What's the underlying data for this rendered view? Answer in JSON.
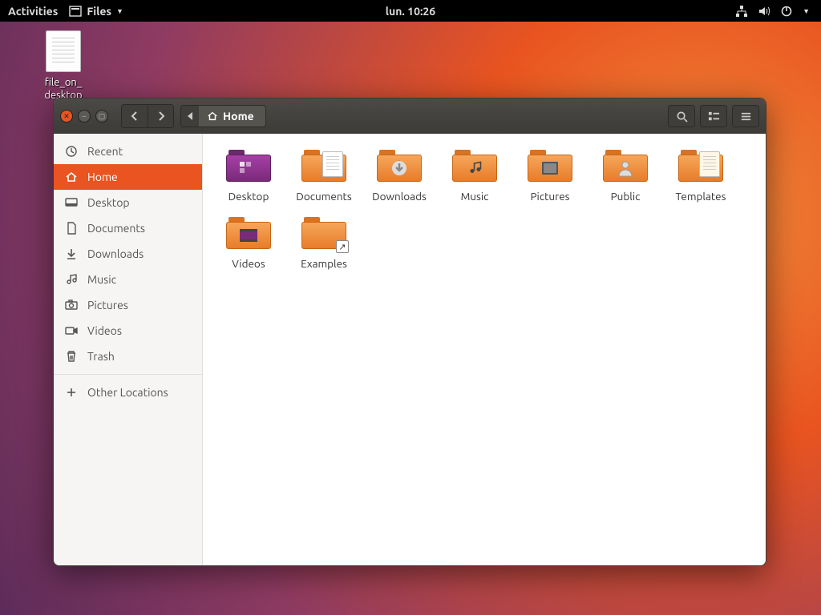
{
  "topbar": {
    "activities": "Activities",
    "app_menu": "Files",
    "clock": "lun. 10:26"
  },
  "desktop": {
    "file_line1": "file_on_",
    "file_line2": "desktop"
  },
  "window": {
    "path_segment": "Home",
    "sidebar": {
      "recent": "Recent",
      "home": "Home",
      "desktop": "Desktop",
      "documents": "Documents",
      "downloads": "Downloads",
      "music": "Music",
      "pictures": "Pictures",
      "videos": "Videos",
      "trash": "Trash",
      "other": "Other Locations"
    },
    "items": {
      "desktop": "Desktop",
      "documents": "Documents",
      "downloads": "Downloads",
      "music": "Music",
      "pictures": "Pictures",
      "public": "Public",
      "templates": "Templates",
      "videos": "Videos",
      "examples": "Examples"
    }
  }
}
